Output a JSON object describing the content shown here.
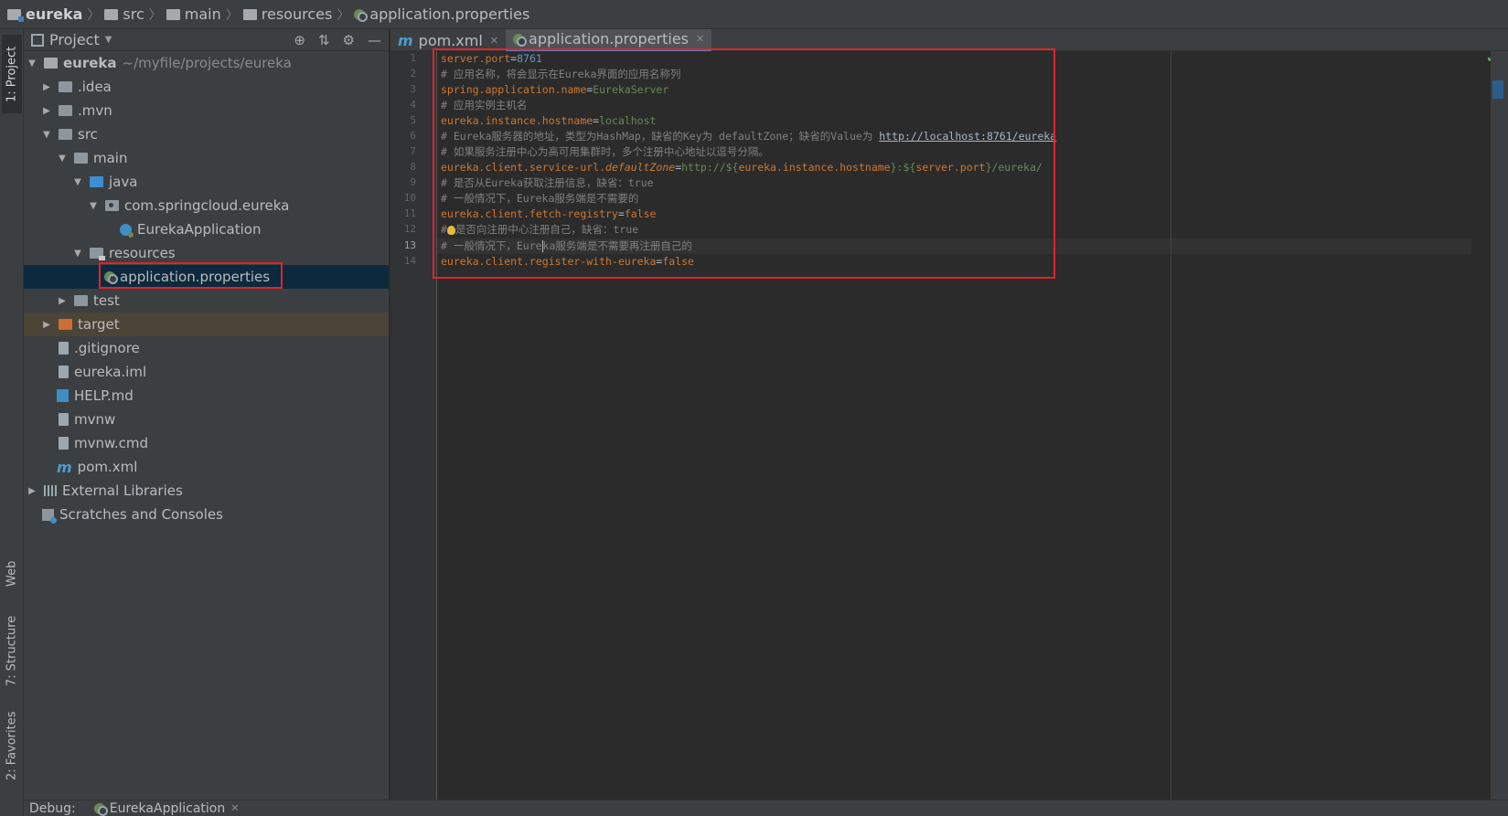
{
  "breadcrumb": {
    "items": [
      {
        "label": "eureka"
      },
      {
        "label": "src"
      },
      {
        "label": "main"
      },
      {
        "label": "resources"
      },
      {
        "label": "application.properties"
      }
    ]
  },
  "left_strip": {
    "project_tab": "1: Project",
    "web_tab": "Web",
    "structure_tab": "7: Structure",
    "favorites_tab": "2: Favorites"
  },
  "project_panel": {
    "title": "Project",
    "tree": [
      {
        "label": "eureka",
        "path": "~/myfile/projects/eureka"
      },
      {
        "label": ".idea"
      },
      {
        "label": ".mvn"
      },
      {
        "label": "src"
      },
      {
        "label": "main"
      },
      {
        "label": "java"
      },
      {
        "label": "com.springcloud.eureka"
      },
      {
        "label": "EurekaApplication"
      },
      {
        "label": "resources"
      },
      {
        "label": "application.properties"
      },
      {
        "label": "test"
      },
      {
        "label": "target"
      },
      {
        "label": ".gitignore"
      },
      {
        "label": "eureka.iml"
      },
      {
        "label": "HELP.md"
      },
      {
        "label": "mvnw"
      },
      {
        "label": "mvnw.cmd"
      },
      {
        "label": "pom.xml"
      },
      {
        "label": "External Libraries"
      },
      {
        "label": "Scratches and Consoles"
      }
    ]
  },
  "editor_tabs": [
    {
      "label": "pom.xml"
    },
    {
      "label": "application.properties"
    }
  ],
  "code": {
    "line_numbers": [
      "1",
      "2",
      "3",
      "4",
      "5",
      "6",
      "7",
      "8",
      "9",
      "10",
      "11",
      "12",
      "13",
      "14"
    ],
    "l1_key": "server.port",
    "l1_eq": "=",
    "l1_val": "8761",
    "l2": "# 应用名称，将会显示在Eureka界面的应用名称列",
    "l3_key": "spring.application.name",
    "l3_eq": "=",
    "l3_val": "EurekaServer",
    "l4": "# 应用实例主机名",
    "l5_key": "eureka.instance.hostname",
    "l5_eq": "=",
    "l5_val": "localhost",
    "l6_text": "# Eureka服务器的地址，类型为HashMap，缺省的Key为 defaultZone；缺省的Value为 ",
    "l6_url": "http://localhost:8761/eureka",
    "l7": "# 如果服务注册中心为高可用集群时，多个注册中心地址以逗号分隔。",
    "l8_key": "eureka.client.service-url.",
    "l8_key_it": "defaultZone",
    "l8_eq": "=",
    "l8_val1": "http://${",
    "l8_ref1": "eureka.instance.hostname",
    "l8_val2": "}:${",
    "l8_ref2": "server.port",
    "l8_val3": "}/eureka/",
    "l9": "# 是否从Eureka获取注册信息，缺省：true",
    "l10": "# 一般情况下，Eureka服务端是不需要的",
    "l11_key": "eureka.client.fetch-registry",
    "l11_eq": "=",
    "l11_val": "false",
    "l12_a": "#",
    "l12_b": "是否向注册中心注册自己，缺省：true",
    "l13_a": "# 一般情况下，Eure",
    "l13_b": "ka服务端是不需要再注册自己的",
    "l14_key": "eureka.client.register-with-eureka",
    "l14_eq": "=",
    "l14_val": "false"
  },
  "bottom_bar": {
    "debug_label": "Debug:",
    "session": "EurekaApplication"
  }
}
